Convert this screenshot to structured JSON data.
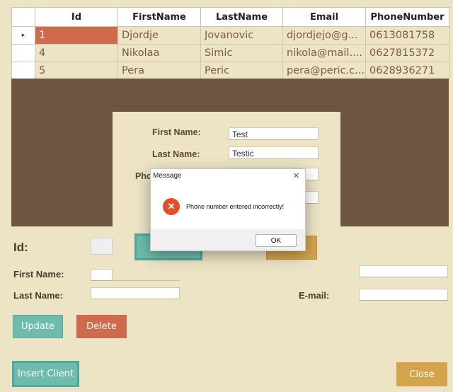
{
  "grid": {
    "columns": [
      "Id",
      "FirstName",
      "LastName",
      "Email",
      "PhoneNumber"
    ],
    "rows": [
      {
        "id": "1",
        "first": "Djordje",
        "last": "Jovanovic",
        "email": "djordjejo@g...",
        "phone": "0613081758"
      },
      {
        "id": "4",
        "first": "Nikolaa",
        "last": "Simic",
        "email": "nikola@mail....",
        "phone": "0627815372"
      },
      {
        "id": "5",
        "first": "Pera",
        "last": "Peric",
        "email": "pera@peric.c...",
        "phone": "0628936271"
      }
    ],
    "row_indicator": "▸"
  },
  "panel": {
    "first_name_label": "First Name:",
    "first_name_value": "Test",
    "last_name_label": "Last Name:",
    "last_name_value": "Testic",
    "phone_label_partial": "Pho"
  },
  "form": {
    "id_label": "Id:",
    "first_name_label": "First Name:",
    "last_name_label": "Last Name:",
    "email_label": "E-mail:",
    "update_label": "Update",
    "delete_label": "Delete",
    "insert_label": "Insert Client",
    "close_label": "Close"
  },
  "dialog": {
    "title": "Message",
    "close_glyph": "✕",
    "error_glyph": "✕",
    "message": "Phone number entered incorrectly!",
    "ok_label": "OK"
  },
  "colors": {
    "background": "#ede4c6",
    "dark_panel": "#6e5441",
    "selection": "#d06a4c",
    "teal": "#6dbcae",
    "gold": "#d4a44c",
    "error_red": "#e44d26"
  }
}
